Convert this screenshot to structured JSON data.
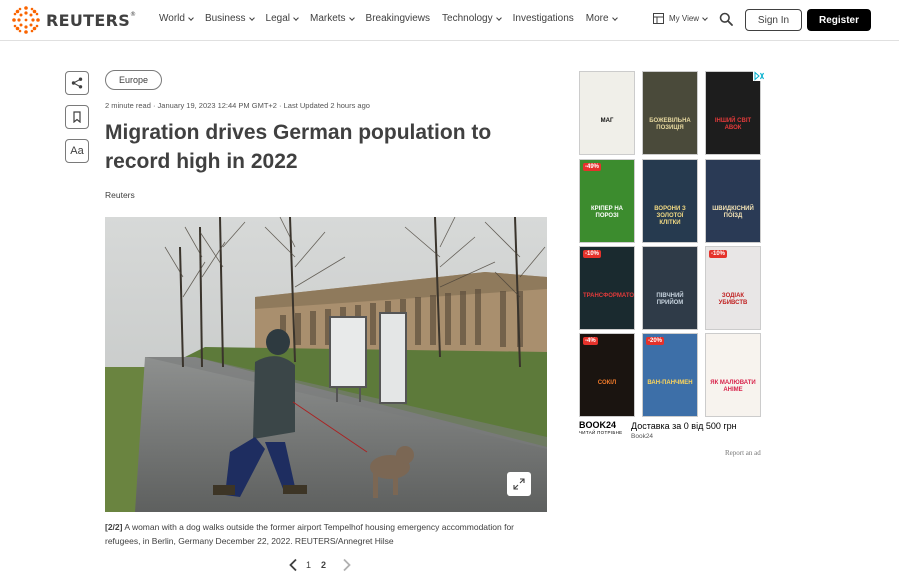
{
  "header": {
    "logo_text": "REUTERS",
    "logo_mark": "®",
    "nav": [
      {
        "label": "World",
        "dropdown": true
      },
      {
        "label": "Business",
        "dropdown": true
      },
      {
        "label": "Legal",
        "dropdown": true
      },
      {
        "label": "Markets",
        "dropdown": true
      },
      {
        "label": "Breakingviews",
        "dropdown": false
      },
      {
        "label": "Technology",
        "dropdown": true
      },
      {
        "label": "Investigations",
        "dropdown": false
      },
      {
        "label": "More",
        "dropdown": true
      }
    ],
    "my_view": "My View",
    "sign_in": "Sign In",
    "register": "Register"
  },
  "tools": {
    "share_icon": "share-icon",
    "bookmark_icon": "bookmark-icon",
    "text_size_label": "Aa"
  },
  "article": {
    "section_tag": "Europe",
    "meta": "2 minute read · January 19, 2023 12:44 PM GMT+2 · Last Updated 2 hours ago",
    "headline": "Migration drives German population to record high in 2022",
    "byline": "Reuters",
    "caption_index": "[2/2]",
    "caption": " A woman with a dog walks outside the former airport Tempelhof housing emergency accommodation for refugees, in Berlin, Germany December 22, 2022. REUTERS/Annegret Hilse",
    "pager": {
      "pages": [
        "1",
        "2"
      ],
      "current": "2"
    }
  },
  "ad": {
    "books": [
      {
        "title": "МАГ",
        "badge": "",
        "bg": "#f0efe9",
        "fg": "#111"
      },
      {
        "title": "БОЖЕВІЛЬНА ПОЗИЦІЯ",
        "badge": "",
        "bg": "#4a4a3a",
        "fg": "#e8d9a0"
      },
      {
        "title": "ІНШИЙ СВІТ АВОК",
        "badge": "",
        "bg": "#1d1d1d",
        "fg": "#e23a3a"
      },
      {
        "title": "КРІПЕР НА ПОРОЗІ",
        "badge": "-49%",
        "bg": "#3c8c2e",
        "fg": "#ffffff"
      },
      {
        "title": "ВОРОНИ З ЗОЛОТОЇ КЛІТКИ",
        "badge": "",
        "bg": "#263a4f",
        "fg": "#f1d983"
      },
      {
        "title": "ШВИДКІСНИЙ ПОЇЗД",
        "badge": "",
        "bg": "#2a3a55",
        "fg": "#f4e3b5"
      },
      {
        "title": "ТРАНСФОРМАТОР",
        "badge": "-10%",
        "bg": "#1a2a2f",
        "fg": "#e23a3a"
      },
      {
        "title": "ПІВЧНИЙ ПРИЙОМ",
        "badge": "",
        "bg": "#2f3b48",
        "fg": "#c7d3de"
      },
      {
        "title": "ЗОДІАК УБИВСТВ",
        "badge": "-10%",
        "bg": "#e8e6e6",
        "fg": "#c02222"
      },
      {
        "title": "СОКІЛ",
        "badge": "-4%",
        "bg": "#1a1410",
        "fg": "#f07a2a"
      },
      {
        "title": "ВАН-ПАНЧМЕН",
        "badge": "-20%",
        "bg": "#3d6fa8",
        "fg": "#ffd65a"
      },
      {
        "title": "ЯК МАЛЮВАТИ АНІМЕ",
        "badge": "",
        "bg": "#f7f3ee",
        "fg": "#d8244c"
      }
    ],
    "brand": "BOOK24",
    "brand_tagline": "ЧИТАЙ ПОТРІБНЕ",
    "offer": "Доставка за 0 від 500 грн",
    "advertiser": "Book24",
    "report": "Report an ad"
  }
}
